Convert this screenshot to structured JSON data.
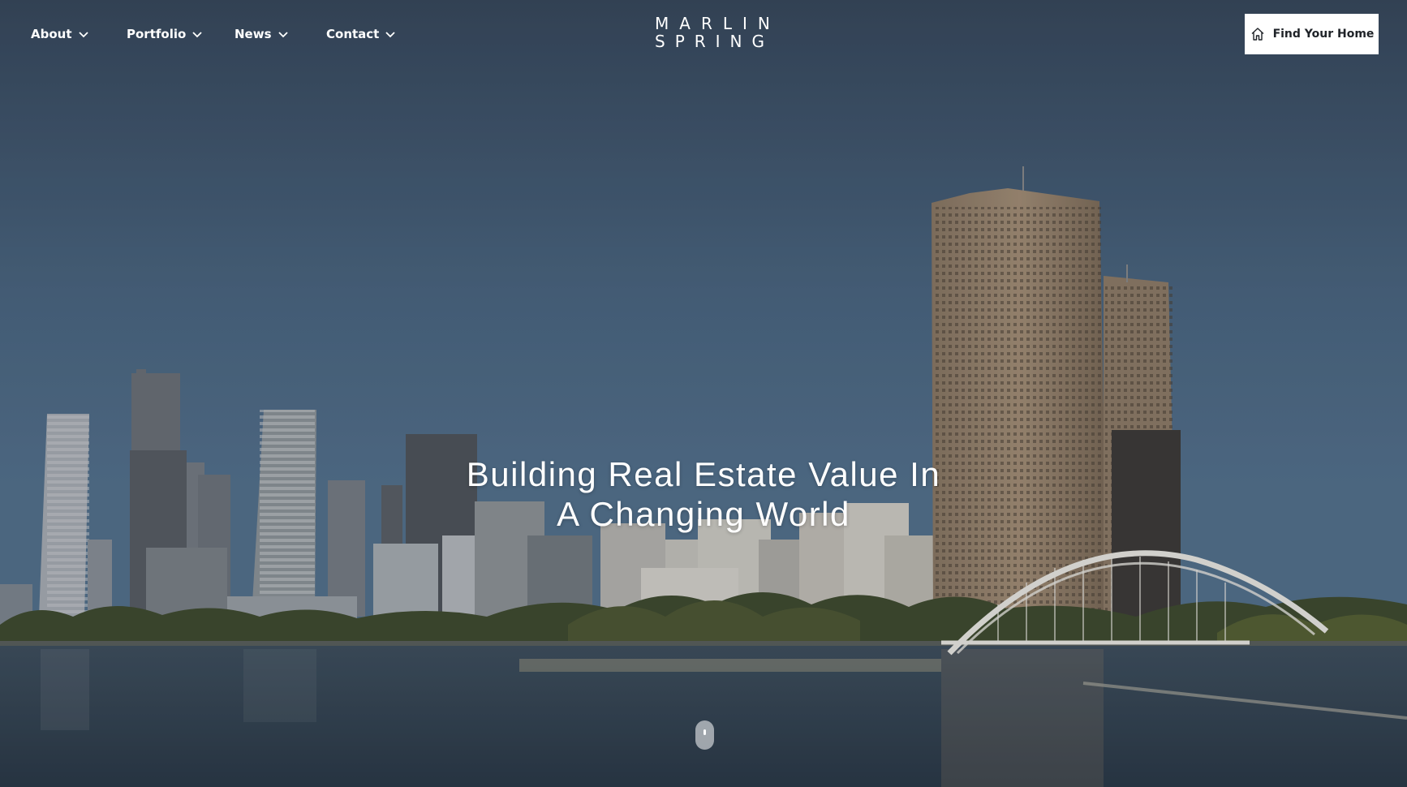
{
  "nav": {
    "items": [
      {
        "label": "About"
      },
      {
        "label": "Portfolio"
      },
      {
        "label": "News"
      },
      {
        "label": "Contact"
      }
    ]
  },
  "logo": {
    "line1": "MARLIN",
    "line2": "SPRING"
  },
  "cta": {
    "label": "Find Your Home",
    "icon": "home-icon"
  },
  "hero": {
    "headline_line1": "Building Real Estate Value In",
    "headline_line2": "A Changing World",
    "background": "city-skyline-waterfront-video",
    "scroll_icon": "mouse-scroll-icon"
  },
  "colors": {
    "sky_top": "#3a4a5e",
    "sky_bottom": "#4e6a86",
    "water": "#2f3c4a",
    "cta_background": "#ffffff",
    "cta_text": "#1f2328",
    "nav_text": "#ffffff"
  }
}
